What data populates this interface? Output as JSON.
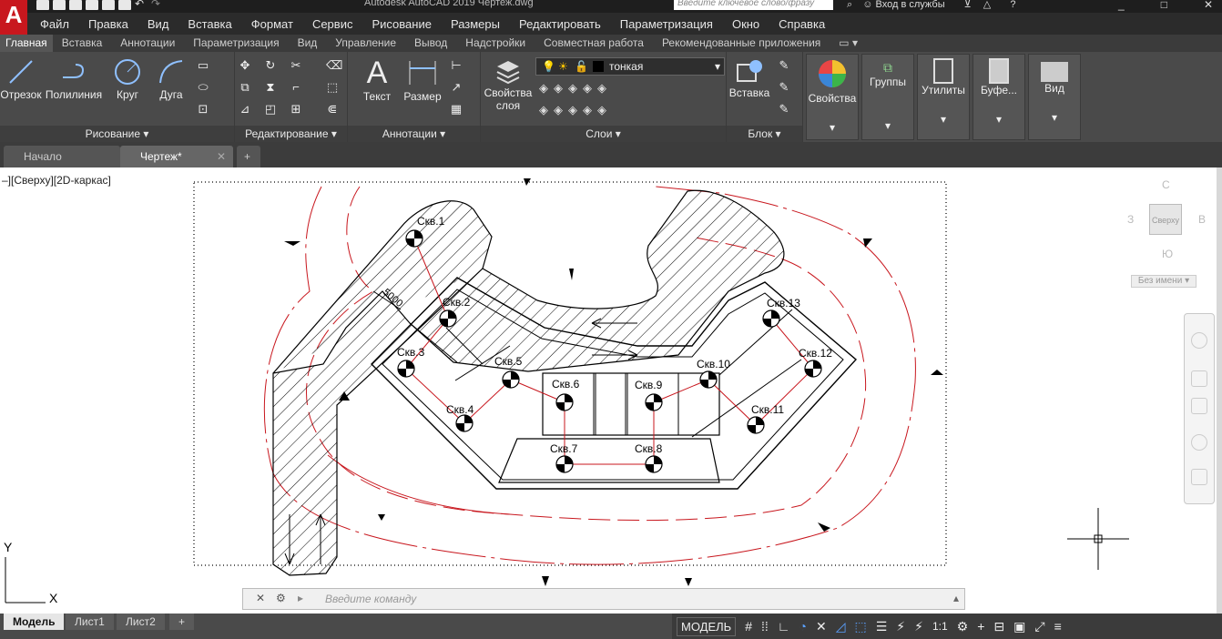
{
  "app": {
    "logo": "A",
    "title": "Autodesk AutoCAD 2019    Чертеж.dwg",
    "search_placeholder": "Введите ключевое слово/фразу",
    "signin": "Вход в службы",
    "colors": {
      "accent": "#c8171e",
      "redline": "#c8171e"
    }
  },
  "menu": [
    "Файл",
    "Правка",
    "Вид",
    "Вставка",
    "Формат",
    "Сервис",
    "Рисование",
    "Размеры",
    "Редактировать",
    "Параметризация",
    "Окно",
    "Справка"
  ],
  "ribbon_tabs": [
    "Главная",
    "Вставка",
    "Аннотации",
    "Параметризация",
    "Вид",
    "Управление",
    "Вывод",
    "Надстройки",
    "Совместная работа",
    "Рекомендованные приложения"
  ],
  "ribbon": {
    "draw": {
      "title": "Рисование",
      "line": "Отрезок",
      "polyline": "Полилиния",
      "circle": "Круг",
      "arc": "Дуга"
    },
    "modify": {
      "title": "Редактирование"
    },
    "annotation": {
      "title": "Аннотации",
      "text": "Текст",
      "dimension": "Размер"
    },
    "layers": {
      "title": "Слои",
      "props_line1": "Свойства",
      "props_line2": "слоя",
      "current_layer": "тонкая"
    },
    "block": {
      "title": "Блок",
      "insert": "Вставка"
    },
    "properties": "Свойства",
    "groups": "Группы",
    "utilities": "Утилиты",
    "clipboard": "Буфе...",
    "view": "Вид"
  },
  "doc_tabs": [
    "Начало",
    "Чертеж*"
  ],
  "viewport": {
    "label": "–][Сверху][2D-каркас]"
  },
  "viewcube": {
    "north": "С",
    "south": "Ю",
    "west": "З",
    "east": "В",
    "face": "Сверху",
    "ucs": "Без имени"
  },
  "drawing": {
    "dimension_text": "5000",
    "wells": [
      "Скв.1",
      "Скв.2",
      "Скв.3",
      "Скв.4",
      "Скв.5",
      "Скв.6",
      "Скв.7",
      "Скв.8",
      "Скв.9",
      "Скв.10",
      "Скв.11",
      "Скв.12",
      "Скв.13"
    ]
  },
  "ucs_icon": {
    "y": "Y",
    "x": "X"
  },
  "command": {
    "placeholder": "Введите команду"
  },
  "layout_tabs": [
    "Модель",
    "Лист1",
    "Лист2"
  ],
  "status": {
    "model": "МОДЕЛЬ",
    "scale": "1:1"
  }
}
